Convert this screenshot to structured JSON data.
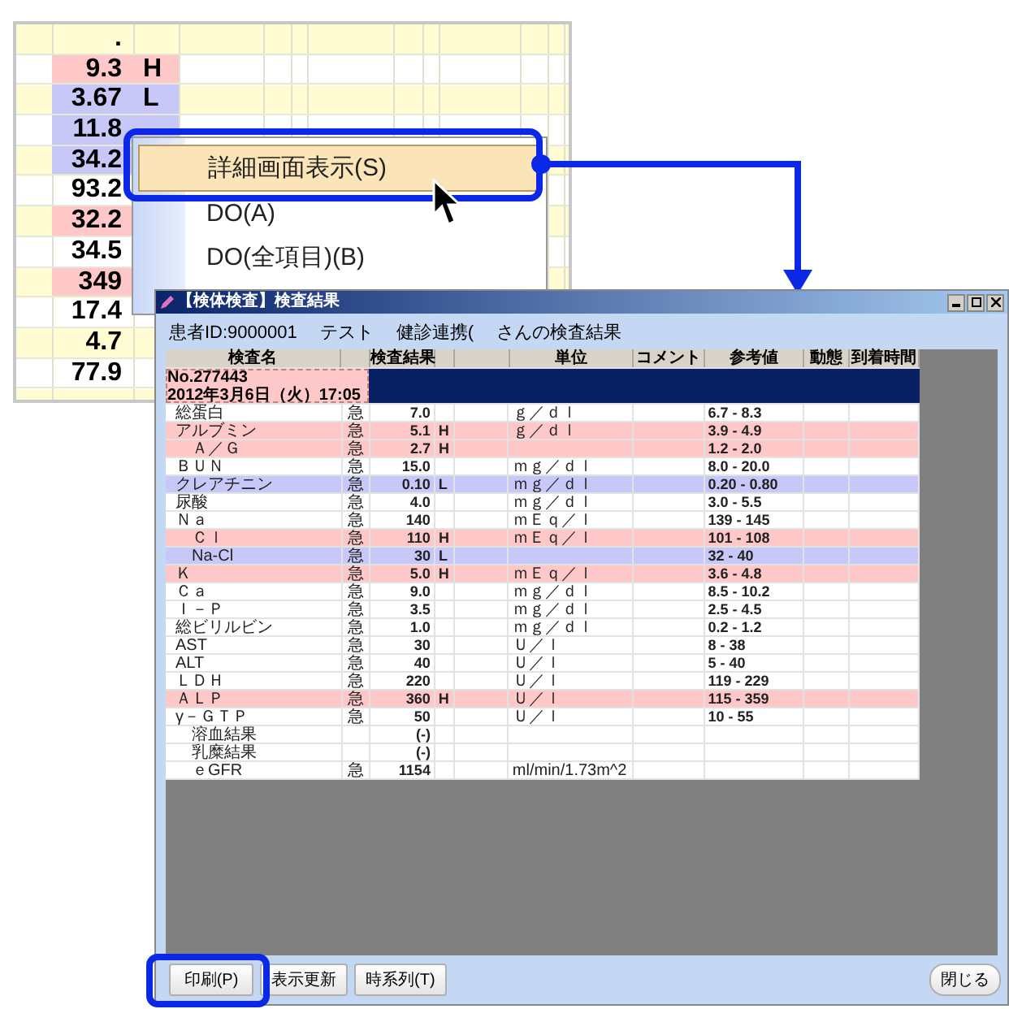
{
  "sheet": {
    "rows": [
      {
        "value": ".",
        "flag": "",
        "high": false,
        "low": false
      },
      {
        "value": "9.3",
        "flag": "H",
        "high": true,
        "low": false
      },
      {
        "value": "3.67",
        "flag": "L",
        "high": false,
        "low": true
      },
      {
        "value": "11.8",
        "flag": "",
        "high": false,
        "low": true
      },
      {
        "value": "34.2",
        "flag": "",
        "high": false,
        "low": true
      },
      {
        "value": "93.2",
        "flag": "",
        "high": false,
        "low": false
      },
      {
        "value": "32.2",
        "flag": "",
        "high": true,
        "low": false
      },
      {
        "value": "34.5",
        "flag": "",
        "high": false,
        "low": false
      },
      {
        "value": "349",
        "flag": "",
        "high": true,
        "low": false
      },
      {
        "value": "17.4",
        "flag": "",
        "high": false,
        "low": false
      },
      {
        "value": "4.7",
        "flag": "",
        "high": false,
        "low": false
      },
      {
        "value": "77.9",
        "flag": "",
        "high": false,
        "low": false
      }
    ]
  },
  "context_menu": {
    "items": [
      {
        "label": "詳細画面表示(S)",
        "selected": true
      },
      {
        "label": "DO(A)",
        "selected": false
      },
      {
        "label": "DO(全項目)(B)",
        "selected": false
      }
    ]
  },
  "window": {
    "title": "【検体検査】検査結果",
    "patient_header": [
      "患者ID:9000001",
      "テスト",
      "健診連携(",
      "さんの検査結果"
    ],
    "table": {
      "columns": [
        "検査名",
        "",
        "検査結果",
        "",
        "",
        "単位",
        "コメント",
        "参考値",
        "動態",
        "到着時間"
      ],
      "order": {
        "number": "No.277443",
        "date": "2012年3月6日（火）17:05"
      },
      "rows": [
        {
          "name": "総蛋白",
          "kind": "main",
          "urgent": "急",
          "result": "7.0",
          "flag": "",
          "unit": "ｇ／ｄｌ",
          "reference": "6.7 - 8.3",
          "high": false,
          "low": false
        },
        {
          "name": "アルブミン",
          "kind": "main",
          "urgent": "急",
          "result": "5.1",
          "flag": "H",
          "unit": "ｇ／ｄｌ",
          "reference": "3.9 - 4.9",
          "high": true,
          "low": false
        },
        {
          "name": "Ａ／Ｇ",
          "kind": "sub",
          "urgent": "急",
          "result": "2.7",
          "flag": "H",
          "unit": "",
          "reference": "1.2 - 2.0",
          "high": true,
          "low": false
        },
        {
          "name": "ＢＵＮ",
          "kind": "main",
          "urgent": "急",
          "result": "15.0",
          "flag": "",
          "unit": "ｍｇ／ｄｌ",
          "reference": "8.0 - 20.0",
          "high": false,
          "low": false
        },
        {
          "name": "クレアチニン",
          "kind": "main",
          "urgent": "急",
          "result": "0.10",
          "flag": "L",
          "unit": "ｍｇ／ｄｌ",
          "reference": "0.20 - 0.80",
          "high": false,
          "low": true
        },
        {
          "name": "尿酸",
          "kind": "main",
          "urgent": "急",
          "result": "4.0",
          "flag": "",
          "unit": "ｍｇ／ｄｌ",
          "reference": "3.0 - 5.5",
          "high": false,
          "low": false
        },
        {
          "name": "Ｎａ",
          "kind": "main",
          "urgent": "急",
          "result": "140",
          "flag": "",
          "unit": "ｍＥｑ／ｌ",
          "reference": "139 - 145",
          "high": false,
          "low": false
        },
        {
          "name": "Ｃｌ",
          "kind": "sub",
          "urgent": "急",
          "result": "110",
          "flag": "H",
          "unit": "ｍＥｑ／ｌ",
          "reference": "101 - 108",
          "high": true,
          "low": false
        },
        {
          "name": "Na-Cl",
          "kind": "sub",
          "urgent": "急",
          "result": "30",
          "flag": "L",
          "unit": "",
          "reference": "32 - 40",
          "high": false,
          "low": true
        },
        {
          "name": "Ｋ",
          "kind": "main",
          "urgent": "急",
          "result": "5.0",
          "flag": "H",
          "unit": "ｍＥｑ／ｌ",
          "reference": "3.6 - 4.8",
          "high": true,
          "low": false
        },
        {
          "name": "Ｃａ",
          "kind": "main",
          "urgent": "急",
          "result": "9.0",
          "flag": "",
          "unit": "ｍｇ／ｄｌ",
          "reference": "8.5 - 10.2",
          "high": false,
          "low": false
        },
        {
          "name": "Ｉ－Ｐ",
          "kind": "main",
          "urgent": "急",
          "result": "3.5",
          "flag": "",
          "unit": "ｍｇ／ｄｌ",
          "reference": "2.5 - 4.5",
          "high": false,
          "low": false
        },
        {
          "name": "総ビリルビン",
          "kind": "main",
          "urgent": "急",
          "result": "1.0",
          "flag": "",
          "unit": "ｍｇ／ｄｌ",
          "reference": "0.2 - 1.2",
          "high": false,
          "low": false
        },
        {
          "name": "AST",
          "kind": "main",
          "urgent": "急",
          "result": "30",
          "flag": "",
          "unit": "Ｕ／ｌ",
          "reference": "8 - 38",
          "high": false,
          "low": false
        },
        {
          "name": "ALT",
          "kind": "main",
          "urgent": "急",
          "result": "40",
          "flag": "",
          "unit": "Ｕ／ｌ",
          "reference": "5 - 40",
          "high": false,
          "low": false
        },
        {
          "name": "ＬＤＨ",
          "kind": "main",
          "urgent": "急",
          "result": "220",
          "flag": "",
          "unit": "Ｕ／ｌ",
          "reference": "119 - 229",
          "high": false,
          "low": false
        },
        {
          "name": "ＡＬＰ",
          "kind": "main",
          "urgent": "急",
          "result": "360",
          "flag": "H",
          "unit": "Ｕ／ｌ",
          "reference": "115 - 359",
          "high": true,
          "low": false
        },
        {
          "name": "γ－ＧＴＰ",
          "kind": "main",
          "urgent": "急",
          "result": "50",
          "flag": "",
          "unit": "Ｕ／ｌ",
          "reference": "10 - 55",
          "high": false,
          "low": false
        },
        {
          "name": "溶血結果",
          "kind": "sub",
          "urgent": "",
          "result": "(-)",
          "flag": "",
          "unit": "",
          "reference": "",
          "high": false,
          "low": false
        },
        {
          "name": "乳糜結果",
          "kind": "sub",
          "urgent": "",
          "result": "(-)",
          "flag": "",
          "unit": "",
          "reference": "",
          "high": false,
          "low": false
        },
        {
          "name": "ｅGFR",
          "kind": "sub",
          "urgent": "急",
          "result": "1154",
          "flag": "",
          "unit": "ml/min/1.73m^2",
          "reference": "",
          "high": false,
          "low": false
        }
      ]
    },
    "buttons": [
      {
        "label": "印刷(P)",
        "kind": "left"
      },
      {
        "label": "表示更新",
        "kind": "left"
      },
      {
        "label": "時系列(T)",
        "kind": "left"
      },
      {
        "label": "閉じる",
        "kind": "right"
      }
    ]
  }
}
